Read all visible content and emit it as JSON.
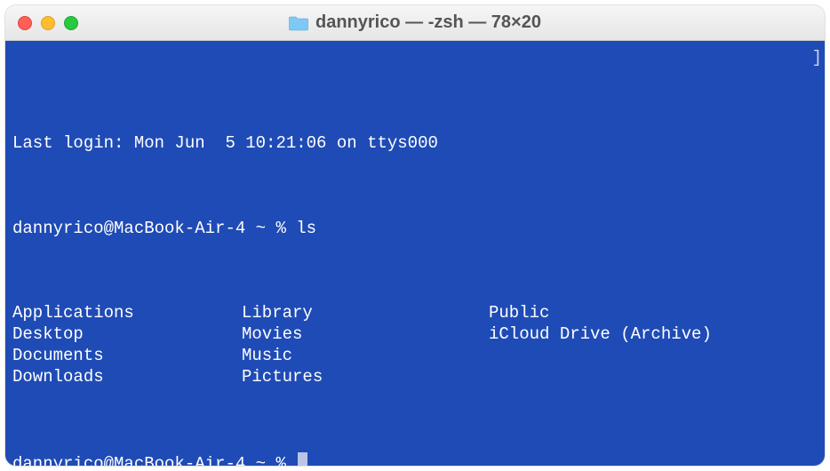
{
  "window": {
    "title": "dannyrico — -zsh — 78×20"
  },
  "terminal": {
    "last_login": "Last login: Mon Jun  5 10:21:06 on ttys000",
    "prompt1_user": "dannyrico@MacBook-Air-4 ~ % ",
    "prompt1_cmd": "ls",
    "ls": {
      "col1": [
        "Applications",
        "Desktop",
        "Documents",
        "Downloads"
      ],
      "col2": [
        "Library",
        "Movies",
        "Music",
        "Pictures"
      ],
      "col3": [
        "Public",
        "iCloud Drive (Archive)",
        "",
        ""
      ]
    },
    "prompt2_user": "dannyrico@MacBook-Air-4 ~ % "
  }
}
